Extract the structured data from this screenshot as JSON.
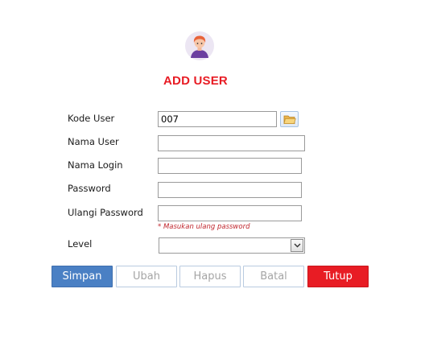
{
  "form": {
    "title": "ADD USER",
    "fields": {
      "kode_user": {
        "label": "Kode User",
        "value": "007"
      },
      "nama_user": {
        "label": "Nama User",
        "value": ""
      },
      "nama_login": {
        "label": "Nama Login",
        "value": ""
      },
      "password": {
        "label": "Password",
        "value": ""
      },
      "ulangi_password": {
        "label": "Ulangi Password",
        "value": "",
        "hint": "* Masukan ulang password"
      },
      "level": {
        "label": "Level",
        "value": ""
      }
    },
    "buttons": {
      "simpan": "Simpan",
      "ubah": "Ubah",
      "hapus": "Hapus",
      "batal": "Batal",
      "tutup": "Tutup"
    }
  },
  "icons": {
    "avatar": "user-avatar-icon",
    "browse": "folder-open-icon",
    "dropdown": "chevron-down-icon"
  },
  "colors": {
    "title": "#e81c24",
    "primary_button": "#4a80c4",
    "danger_button": "#e81c24",
    "hint_text": "#c0262d",
    "disabled_text": "#a5a5a5"
  }
}
